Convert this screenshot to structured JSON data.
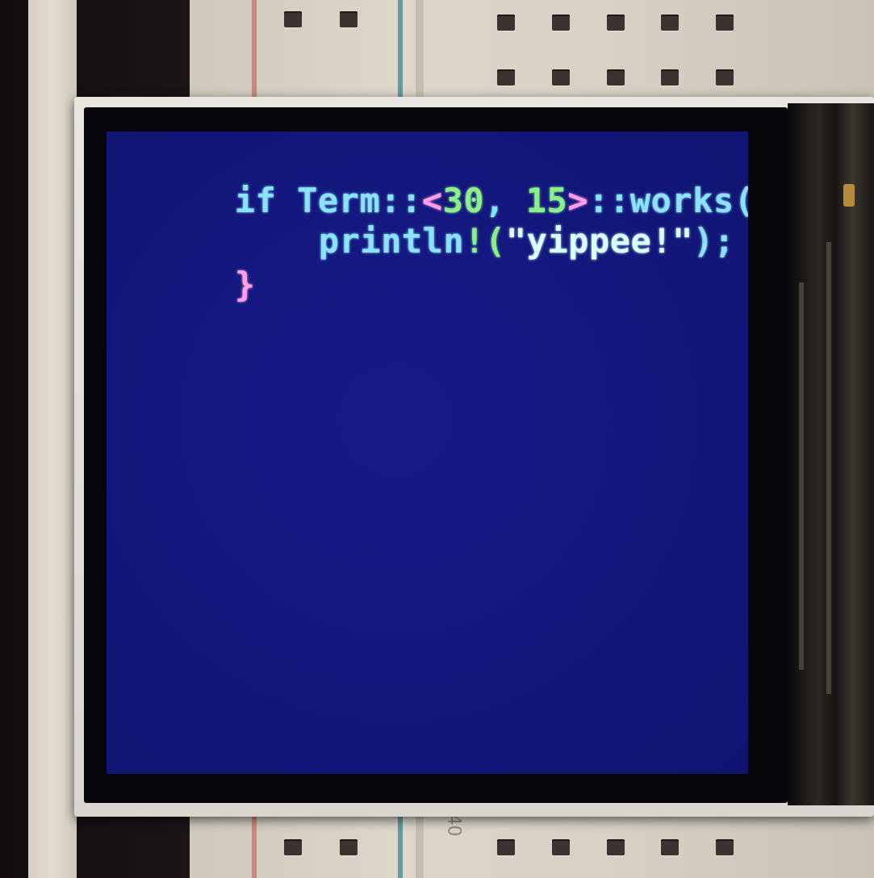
{
  "photo": {
    "subject": "TFT display module on breadboard",
    "breadboard_marking": "40"
  },
  "screen": {
    "background_color": "#13177c",
    "code_lines": [
      [
        {
          "text": "if",
          "kind": "kw"
        },
        {
          "text": " Term::",
          "kind": "id"
        },
        {
          "text": "<",
          "kind": "punct"
        },
        {
          "text": "30",
          "kind": "num"
        },
        {
          "text": ", ",
          "kind": "id"
        },
        {
          "text": "15",
          "kind": "num"
        },
        {
          "text": ">",
          "kind": "punct"
        },
        {
          "text": "::works(t) ",
          "kind": "id"
        },
        {
          "text": "{",
          "kind": "punct"
        }
      ],
      [
        {
          "text": "println",
          "kind": "id"
        },
        {
          "text": "!(",
          "kind": "num"
        },
        {
          "text": "\"yippee!\"",
          "kind": "str"
        },
        {
          "text": ");",
          "kind": "id"
        }
      ],
      [
        {
          "text": "}",
          "kind": "punct"
        }
      ]
    ],
    "colors": {
      "keyword": "#8ae2ff",
      "identifier": "#8ae2ff",
      "number": "#8cf08a",
      "punctuation": "#ff9ee8",
      "string": "#d8ffff"
    }
  }
}
